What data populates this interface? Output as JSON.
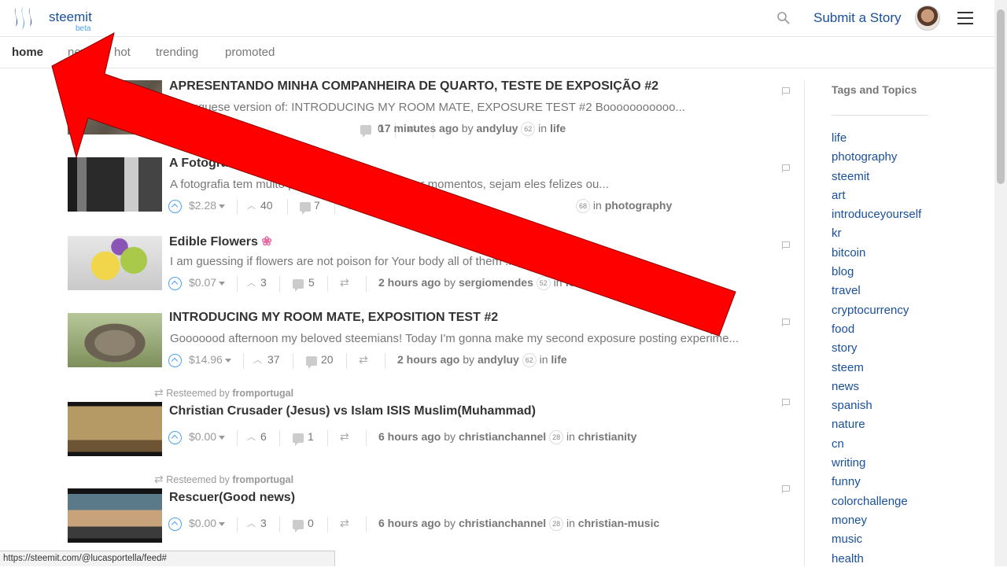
{
  "header": {
    "brand": "steemit",
    "brand_sub": "beta",
    "submit_label": "Submit a Story"
  },
  "tabs": [
    {
      "label": "home",
      "active": true
    },
    {
      "label": "new",
      "active": false
    },
    {
      "label": "hot",
      "active": false
    },
    {
      "label": "trending",
      "active": false
    },
    {
      "label": "promoted",
      "active": false
    }
  ],
  "posts": [
    {
      "title": "APRESENTANDO MINHA COMPANHEIRA DE QUARTO, TESTE DE EXPOSIÇÃO #2",
      "excerpt": "Portuguese version of: INTRODUCING MY ROOM MATE, EXPOSURE TEST #2 Booooooooooo...",
      "payout": "",
      "votes": "",
      "comments": "0",
      "time": "17 minutes ago",
      "author": "andyluy",
      "rep": "62",
      "category": "life",
      "resteemed_by": ""
    },
    {
      "title": "A Fotografia Te",
      "excerpt": "A fotografia tem muito pod... denunciar, eternizar momentos, sejam eles felizes ou...",
      "payout": "$2.28",
      "votes": "40",
      "comments": "7",
      "time": "",
      "author": "",
      "rep": "68",
      "category": "photography",
      "resteemed_by": ""
    },
    {
      "title": "Edible Flowers",
      "title_emoji": "❀",
      "excerpt": "I am guessing if flowers are not poison for Your body all of them ... years ago that beco...",
      "payout": "$0.07",
      "votes": "3",
      "comments": "5",
      "time": "2 hours ago",
      "author": "sergiomendes",
      "rep": "52",
      "category": "foo",
      "resteemed_by": ""
    },
    {
      "title": "INTRODUCING MY ROOM MATE, EXPOSITION TEST #2",
      "excerpt": "Gooooood afternoon my beloved steemians! Today I'm gonna make my second exposure posting experime...",
      "payout": "$14.96",
      "votes": "37",
      "comments": "20",
      "time": "2 hours ago",
      "author": "andyluy",
      "rep": "62",
      "category": "life",
      "resteemed_by": ""
    },
    {
      "title": "Christian Crusader (Jesus) vs Islam ISIS Muslim(Muhammad)",
      "excerpt": "",
      "payout": "$0.00",
      "votes": "6",
      "comments": "1",
      "time": "6 hours ago",
      "author": "christianchannel",
      "rep": "28",
      "category": "christianity",
      "resteemed_by": "fromportugal",
      "resteemed_label": "Resteemed by"
    },
    {
      "title": "Rescuer(Good news)",
      "excerpt": "",
      "payout": "$0.00",
      "votes": "3",
      "comments": "0",
      "time": "6 hours ago",
      "author": "christianchannel",
      "rep": "28",
      "category": "christian-music",
      "resteemed_by": "fromportugal",
      "resteemed_label": "Resteemed by"
    }
  ],
  "sidebar": {
    "title": "Tags and Topics",
    "tags": [
      "life",
      "photography",
      "steemit",
      "art",
      "introduceyourself",
      "kr",
      "bitcoin",
      "blog",
      "travel",
      "cryptocurrency",
      "food",
      "story",
      "steem",
      "news",
      "spanish",
      "nature",
      "cn",
      "writing",
      "funny",
      "colorchallenge",
      "money",
      "music",
      "health"
    ]
  },
  "statusbar": {
    "url": "https://steemit.com/@lucasportella/feed#"
  },
  "colors": {
    "link": "#1a5099",
    "accent": "#4ba2f2",
    "arrow": "#ff0000"
  }
}
